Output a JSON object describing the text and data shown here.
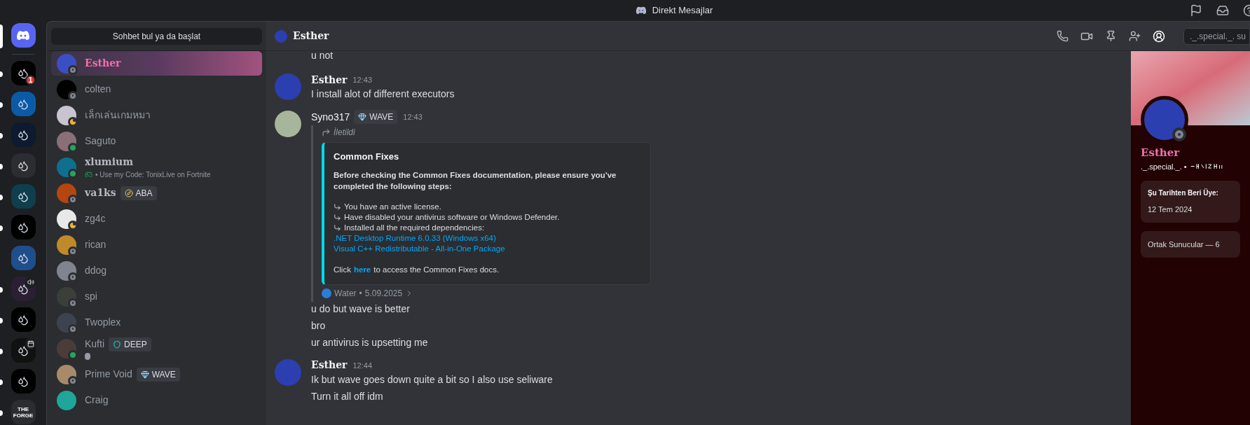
{
  "title_bar": {
    "title": "Direkt Mesajlar"
  },
  "servers": [
    {
      "color": "#000000",
      "unread": true,
      "badge": "1",
      "kind": "plain"
    },
    {
      "color": "#0b5aa8",
      "unread": true,
      "kind": "plain"
    },
    {
      "color": "#0d1a30",
      "unread": true,
      "kind": "plain"
    },
    {
      "color": "#2b2d31",
      "unread": true,
      "kind": "plain"
    },
    {
      "color": "#0f3e4d",
      "unread": true,
      "kind": "plain"
    },
    {
      "color": "#000000",
      "unread": true,
      "kind": "plain"
    },
    {
      "color": "#1f4e8c",
      "unread": false,
      "kind": "plain"
    },
    {
      "color": "#2a1f33",
      "unread": true,
      "kind": "speaker"
    },
    {
      "color": "#000000",
      "unread": true,
      "kind": "plain"
    },
    {
      "color": "#111111",
      "unread": true,
      "kind": "calendar"
    },
    {
      "color": "#000000",
      "unread": true,
      "kind": "plain"
    },
    {
      "color": "#2b2d31",
      "unread": true,
      "kind": "logo",
      "label": "THE FORGE"
    }
  ],
  "dm_list": {
    "search": "Sohbet bul ya da başlat",
    "items": [
      {
        "name": "Esther",
        "fancy": true,
        "kind": "offline",
        "selected": true,
        "color": "#3b4fc4"
      },
      {
        "name": "colten",
        "fancy": false,
        "kind": "offline",
        "selected": false,
        "color": "#000000"
      },
      {
        "name": "เล็กเล่นเกมหมา",
        "fancy": false,
        "kind": "idle",
        "selected": false,
        "color": "#c9c4cf"
      },
      {
        "name": "Saguto",
        "fancy": false,
        "kind": "online",
        "selected": false,
        "color": "#8a6f78"
      },
      {
        "name": "xlumium",
        "fancy": true,
        "kind": "online",
        "selected": false,
        "color": "#0e6f8f",
        "activity": "• Use my Code: TonixLive on Fortnite"
      },
      {
        "name": "va1ks",
        "fancy": true,
        "kind": "offline",
        "selected": false,
        "color": "#b5460f",
        "tag": {
          "kind": "compass",
          "text": "ABA"
        }
      },
      {
        "name": "zg4c",
        "fancy": false,
        "kind": "idle",
        "selected": false,
        "color": "#e8e8e8"
      },
      {
        "name": "rican",
        "fancy": false,
        "kind": "offline",
        "selected": false,
        "color": "#c08a2a"
      },
      {
        "name": "ddog",
        "fancy": false,
        "kind": "offline",
        "selected": false,
        "color": "#80848e"
      },
      {
        "name": "spi",
        "fancy": false,
        "kind": "offline",
        "selected": false,
        "color": "#3a3f3a"
      },
      {
        "name": "Twoplex",
        "fancy": false,
        "kind": "offline",
        "selected": false,
        "color": "#3d4450"
      },
      {
        "name": "Kufti",
        "fancy": false,
        "kind": "online",
        "selected": false,
        "color": "#4a3c38",
        "tag": {
          "kind": "shield",
          "text": "DEEP"
        },
        "status_emoji": true
      },
      {
        "name": "Prime Void",
        "fancy": false,
        "kind": "offline",
        "selected": false,
        "color": "#a88a6a",
        "tag": {
          "kind": "diamond",
          "text": "WAVE"
        }
      },
      {
        "name": "Craig",
        "fancy": false,
        "kind": "unknown",
        "selected": false,
        "color": "#1ea69a"
      }
    ]
  },
  "chat": {
    "header": {
      "name": "Esther",
      "search_placeholder": "._.special._. su"
    },
    "top_line": "u not",
    "groups": [
      {
        "author": "Esther",
        "fancy": true,
        "time": "12:43",
        "color": "#2c3fb0",
        "lines": [
          "I install alot of different executors"
        ]
      },
      {
        "author": "Syno317",
        "fancy": false,
        "time": "12:43",
        "color": "#a7b59a",
        "tag": {
          "kind": "diamond",
          "text": "WAVE"
        },
        "forward": {
          "label": "İletildi",
          "embed": {
            "title": "Common Fixes",
            "description": "Before checking the Common Fixes documentation, please ensure you've completed the following steps:",
            "steps": [
              "You have an active license.",
              "Have disabled your antivirus software or Windows Defender.",
              "Installed all the required dependencies:"
            ],
            "links": [
              ".NET Desktop Runtime 6.0.33 (Windows x64)",
              "Visual C++ Redistributable - All-in-One Package"
            ],
            "footer_before": "Click",
            "footer_link": "here",
            "footer_after": "to access the Common Fixes docs."
          },
          "source": "Water",
          "separator": "•",
          "date": "5.09.2025"
        },
        "lines": [
          "u do but wave is better",
          "bro",
          "ur antivirus is upsetting me"
        ]
      },
      {
        "author": "Esther",
        "fancy": true,
        "time": "12:44",
        "color": "#2c3fb0",
        "lines": [
          "Ik but wave goes down quite a bit so I also use seliware",
          "Turn it all off idm"
        ]
      }
    ]
  },
  "profile": {
    "name": "Esther",
    "handle": "._.special._. •",
    "offline": true,
    "member_label": "Şu Tarihten Beri Üye:",
    "member_date": "12 Tem 2024",
    "mutual_servers": "Ortak Sunucular — 6"
  }
}
